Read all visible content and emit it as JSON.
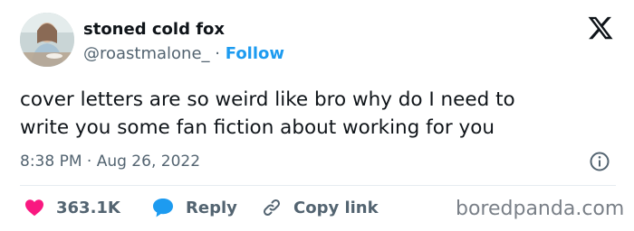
{
  "author": {
    "display_name": "stoned cold fox",
    "handle": "@roastmalone_",
    "separator": "·",
    "follow_label": "Follow"
  },
  "tweet": {
    "lines": [
      "cover letters are so weird like bro why do I need to",
      "write you some fan fiction about working for you"
    ],
    "timestamp": "8:38 PM · Aug 26, 2022"
  },
  "actions": {
    "likes_count": "363.1K",
    "reply_label": "Reply",
    "copy_link_label": "Copy link"
  },
  "icons": {
    "logo": "x-logo-icon",
    "info": "info-icon",
    "like": "heart-icon",
    "reply": "speech-bubble-icon",
    "copy": "link-icon"
  },
  "colors": {
    "accent": "#1d9bf0",
    "heart": "#f91880",
    "muted_text": "#536471",
    "primary_text": "#0f1419"
  },
  "watermark": "boredpanda.com"
}
